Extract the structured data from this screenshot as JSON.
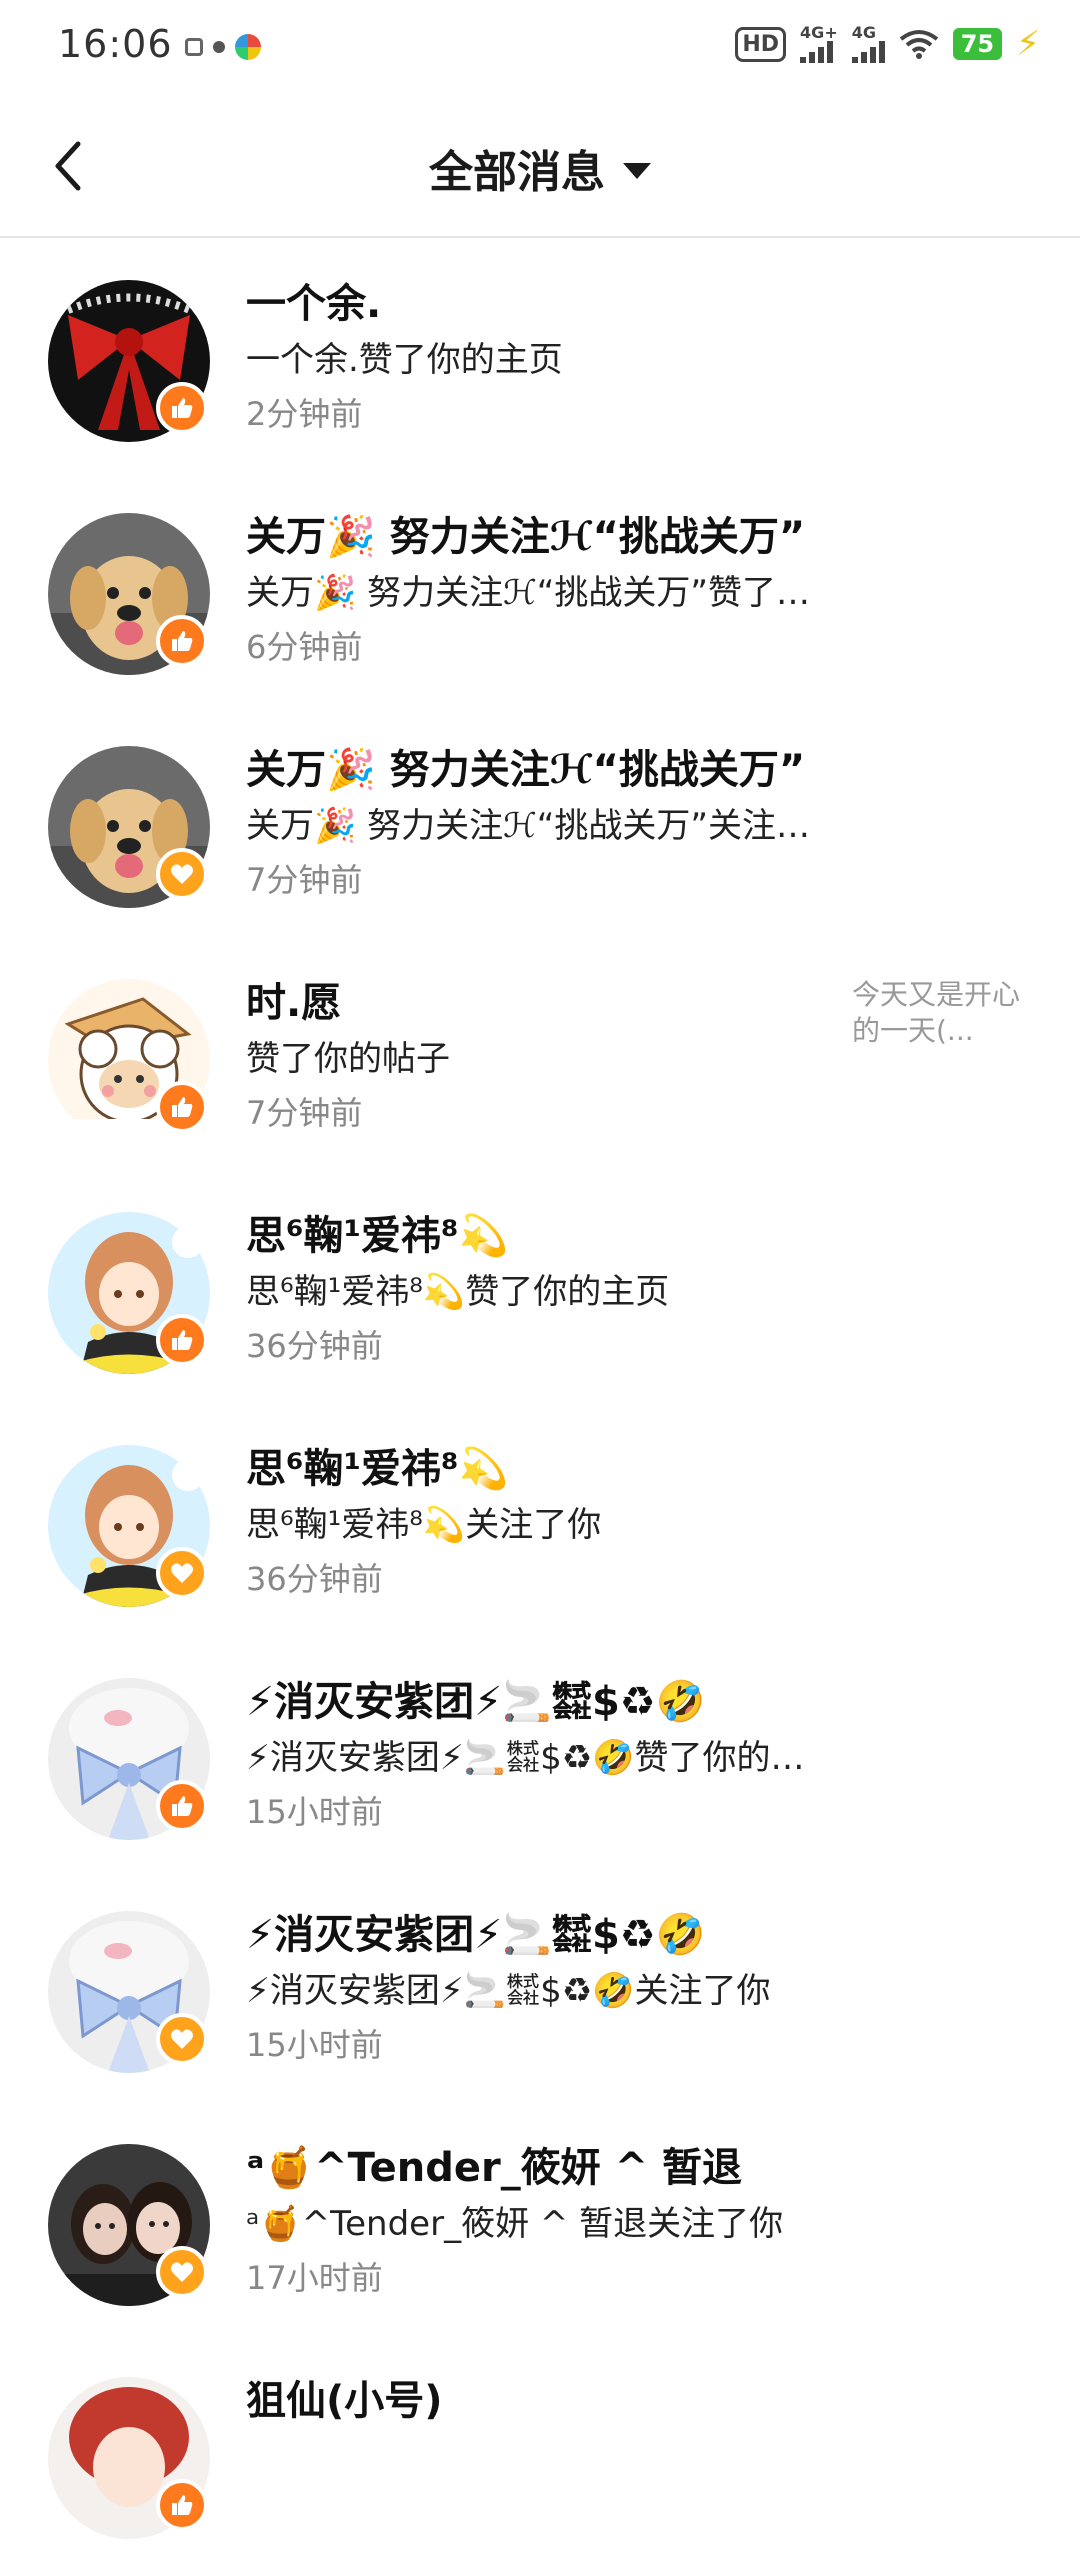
{
  "status_bar": {
    "time": "16:06",
    "hd_label": "HD",
    "signal_1_label": "4G+",
    "signal_2_label": "4G",
    "battery": "75"
  },
  "header": {
    "title": "全部消息",
    "back_icon": "chevron-left-icon",
    "dropdown_icon": "caret-down-icon"
  },
  "colors": {
    "like_badge": "#ff7a1c",
    "follow_badge": "#ffa21c"
  },
  "messages": [
    {
      "name": "一个余.",
      "desc": "一个余.赞了你的主页",
      "time": "2分钟前",
      "type": "like",
      "avatar": "red-bow"
    },
    {
      "name": "关万🎉 努力关注ℋ“挑战关万”",
      "desc": "关万🎉 努力关注ℋ“挑战关万”赞了你的主页",
      "time": "6分钟前",
      "type": "like",
      "avatar": "puppy"
    },
    {
      "name": "关万🎉 努力关注ℋ“挑战关万”",
      "desc": "关万🎉 努力关注ℋ“挑战关万”关注了你",
      "time": "7分钟前",
      "type": "follow",
      "avatar": "puppy"
    },
    {
      "name": "时.愿",
      "desc": "赞了你的帖子",
      "time": "7分钟前",
      "type": "like",
      "avatar": "sheep",
      "preview": "今天又是开心的一天(..."
    },
    {
      "name": "思⁶鞠¹爱祎⁸💫",
      "desc": "思⁶鞠¹爱祎⁸💫赞了你的主页",
      "time": "36分钟前",
      "type": "like",
      "avatar": "anime-girl"
    },
    {
      "name": "思⁶鞠¹爱祎⁸💫",
      "desc": "思⁶鞠¹爱祎⁸💫关注了你",
      "time": "36分钟前",
      "type": "follow",
      "avatar": "anime-girl"
    },
    {
      "name": "⚡消灭安紫团⚡🚬㍿$♻🤣",
      "desc": "⚡消灭安紫团⚡🚬㍿$♻🤣赞了你的主页",
      "time": "15小时前",
      "type": "like",
      "avatar": "blue-bow"
    },
    {
      "name": "⚡消灭安紫团⚡🚬㍿$♻🤣",
      "desc": "⚡消灭安紫团⚡🚬㍿$♻🤣关注了你",
      "time": "15小时前",
      "type": "follow",
      "avatar": "blue-bow"
    },
    {
      "name": "ᵃ🍯^Tender_筱妍 ^ 暂退",
      "desc": "ᵃ🍯^Tender_筱妍 ^ 暂退关注了你",
      "time": "17小时前",
      "type": "follow",
      "avatar": "photo"
    },
    {
      "name": "狙仙(小号)",
      "desc": "",
      "time": "",
      "type": "like",
      "avatar": "red-hair"
    }
  ]
}
